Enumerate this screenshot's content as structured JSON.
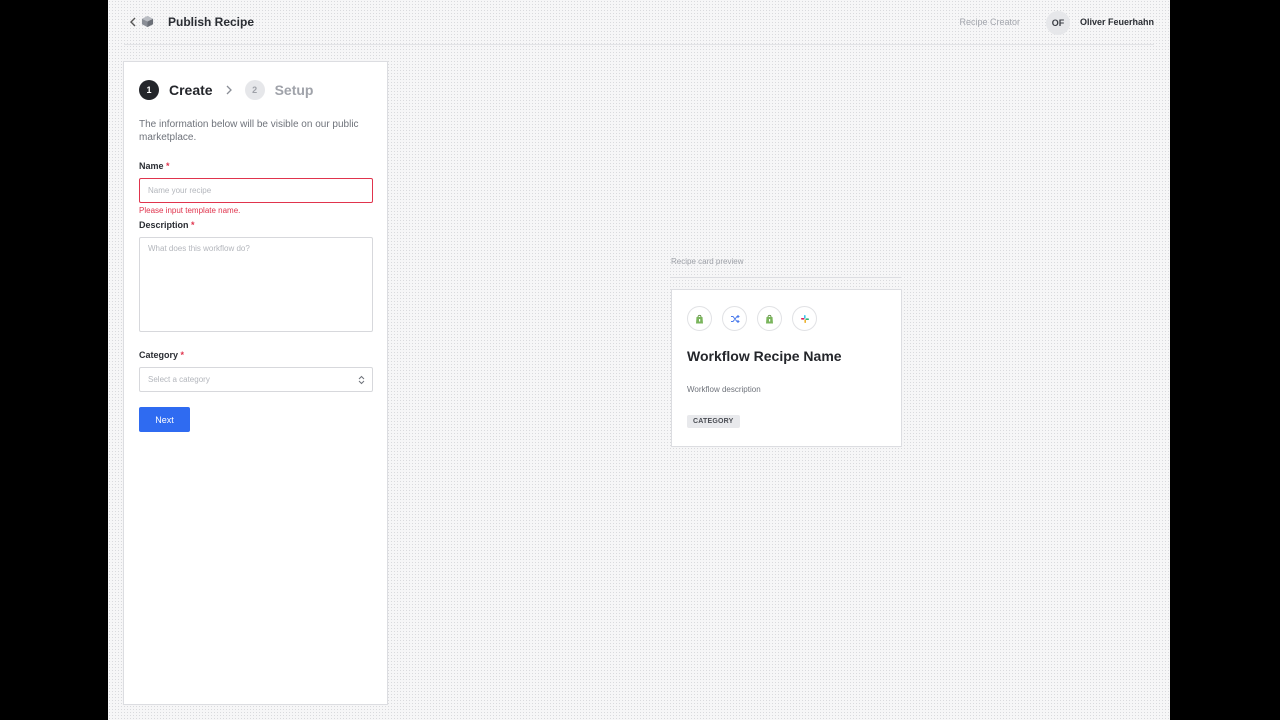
{
  "header": {
    "title": "Publish Recipe",
    "role": "Recipe Creator",
    "user_initials": "OF",
    "user_name": "Oliver Feuerhahn"
  },
  "steps": [
    {
      "number": "1",
      "label": "Create",
      "active": true
    },
    {
      "number": "2",
      "label": "Setup",
      "active": false
    }
  ],
  "form": {
    "intro": "The information below will be visible on our public marketplace.",
    "name_label": "Name",
    "name_placeholder": "Name your recipe",
    "name_error": "Please input template name.",
    "description_label": "Description",
    "description_placeholder": "What does this workflow do?",
    "category_label": "Category",
    "category_placeholder": "Select a category",
    "required_marker": "*",
    "next_label": "Next"
  },
  "preview": {
    "label": "Recipe card preview",
    "icons": [
      "shopify-icon",
      "shuffle-icon",
      "shopify-icon",
      "slack-icon"
    ],
    "title": "Workflow Recipe Name",
    "description": "Workflow description",
    "badge": "CATEGORY"
  },
  "colors": {
    "accent": "#2f6bf1",
    "error": "#e0344d",
    "shopify": "#7ab55c"
  }
}
